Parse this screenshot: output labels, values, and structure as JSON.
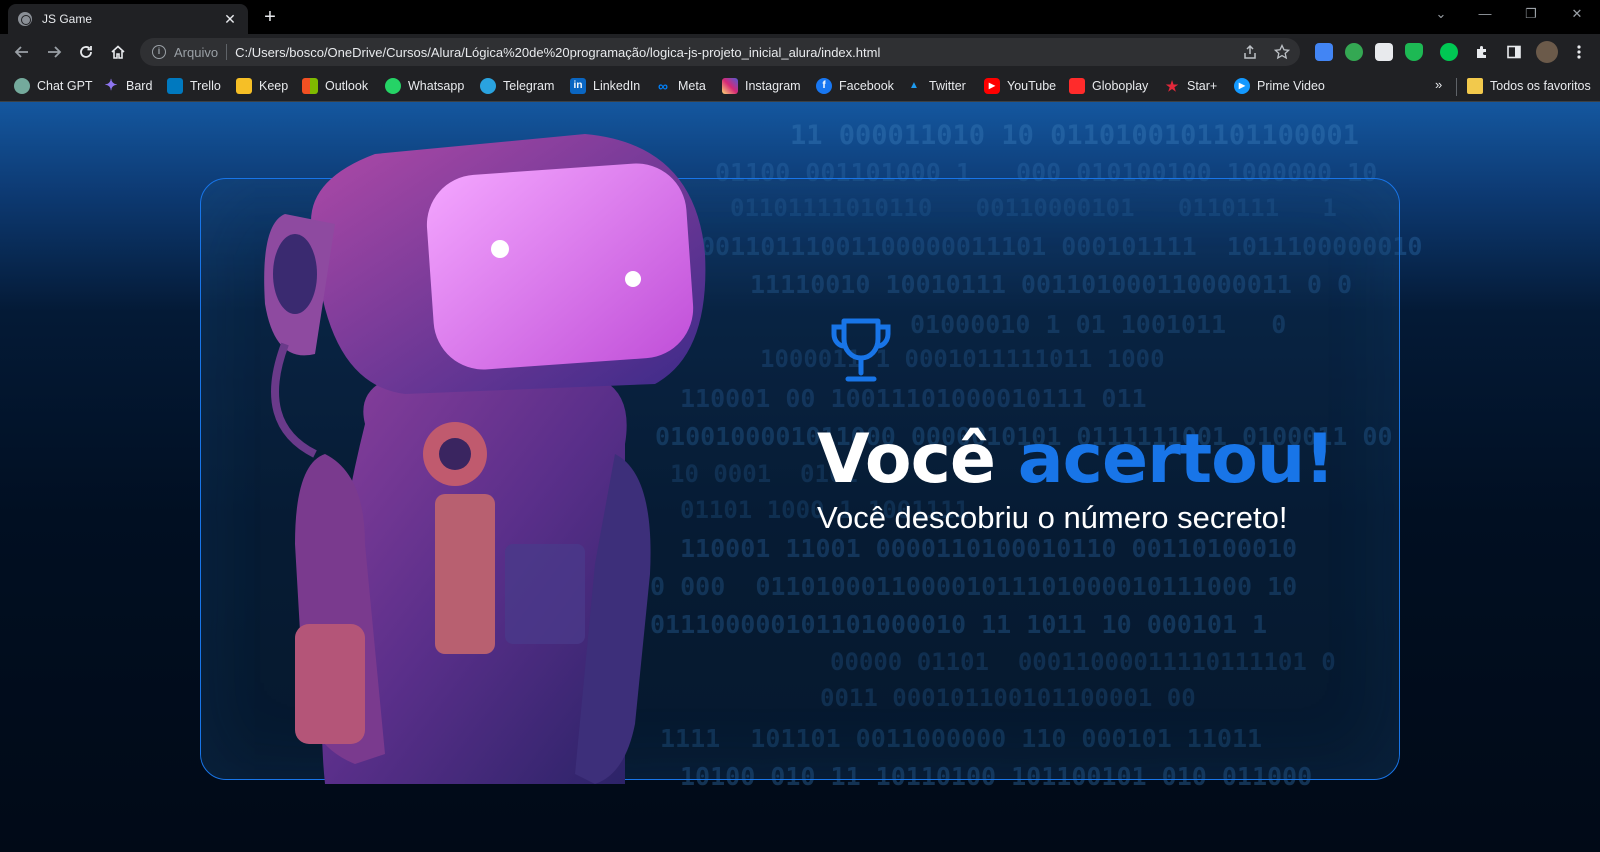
{
  "browser": {
    "tab": {
      "title": "JS Game",
      "close": "✕"
    },
    "new_tab": "+",
    "window_controls": {
      "dropdown": "⌄",
      "minimize": "—",
      "restore": "❐",
      "close": "✕"
    },
    "address_bar": {
      "scheme_label": "Arquivo",
      "url": "C:/Users/bosco/OneDrive/Cursos/Alura/Lógica%20de%20programação/logica-js-projeto_inicial_alura/index.html"
    },
    "bookmarks": [
      {
        "label": "Chat GPT",
        "icon": "chatgpt-icon",
        "color": "#74aa9c"
      },
      {
        "label": "Bard",
        "icon": "bard-icon",
        "color": "#8e75f0"
      },
      {
        "label": "Trello",
        "icon": "trello-icon",
        "color": "#0079bf"
      },
      {
        "label": "Keep",
        "icon": "keep-icon",
        "color": "#f6bf26"
      },
      {
        "label": "Outlook",
        "icon": "outlook-icon",
        "color": "#f25022"
      },
      {
        "label": "Whatsapp",
        "icon": "whatsapp-icon",
        "color": "#25d366"
      },
      {
        "label": "Telegram",
        "icon": "telegram-icon",
        "color": "#2aa3df"
      },
      {
        "label": "LinkedIn",
        "icon": "linkedin-icon",
        "color": "#0a66c2"
      },
      {
        "label": "Meta",
        "icon": "meta-icon",
        "color": "#0081fb"
      },
      {
        "label": "Instagram",
        "icon": "instagram-icon",
        "color": "#d62976"
      },
      {
        "label": "Facebook",
        "icon": "facebook-icon",
        "color": "#1877f2"
      },
      {
        "label": "Twitter",
        "icon": "twitter-icon",
        "color": "#1d9bf0"
      },
      {
        "label": "YouTube",
        "icon": "youtube-icon",
        "color": "#ff0000"
      },
      {
        "label": "Globoplay",
        "icon": "globoplay-icon",
        "color": "#ff2b2b"
      },
      {
        "label": "Star+",
        "icon": "star-plus-icon",
        "color": "#e3283a"
      },
      {
        "label": "Prime Video",
        "icon": "prime-video-icon",
        "color": "#1399ff"
      }
    ],
    "bookmarks_more": "»",
    "all_bookmarks": "Todos os favoritos"
  },
  "game": {
    "headline_white": "Você",
    "headline_accent": "acertou!",
    "subtitle": "Você descobriu o número secreto!",
    "accent_color": "#1875e8"
  },
  "background_binary": [
    "11 000011010 10 0110100101101100001",
    "01100 001101000 1   000 010100100 1000000 10",
    "01101111010110   00110000101   0110111   1",
    "00110111001100000011101 000101111  1011100000010",
    "11110010 10010111 001101000110000011 0 0",
    "01000010 1 01 1001011   0",
    "1000011 1 0001011111011 1000",
    "110001 00 10011101000010111 011",
    "0100100001011000 0000010101 0111111001 0100011 00",
    "10 0001  0101",
    "01101 1000 1 1001111",
    "110001 11001 0000110100010110 00110100010",
    "0 000  011010001100001011101000010111000 10",
    "011100000101101000010 11 1011 10 000101 1",
    "00000 01101  00011000011110111101 0",
    "0011 000101100101100001 00",
    "1111  101101 0011000000 110 000101 11011",
    "10100 010 11 10110100 101100101 010 011000"
  ]
}
